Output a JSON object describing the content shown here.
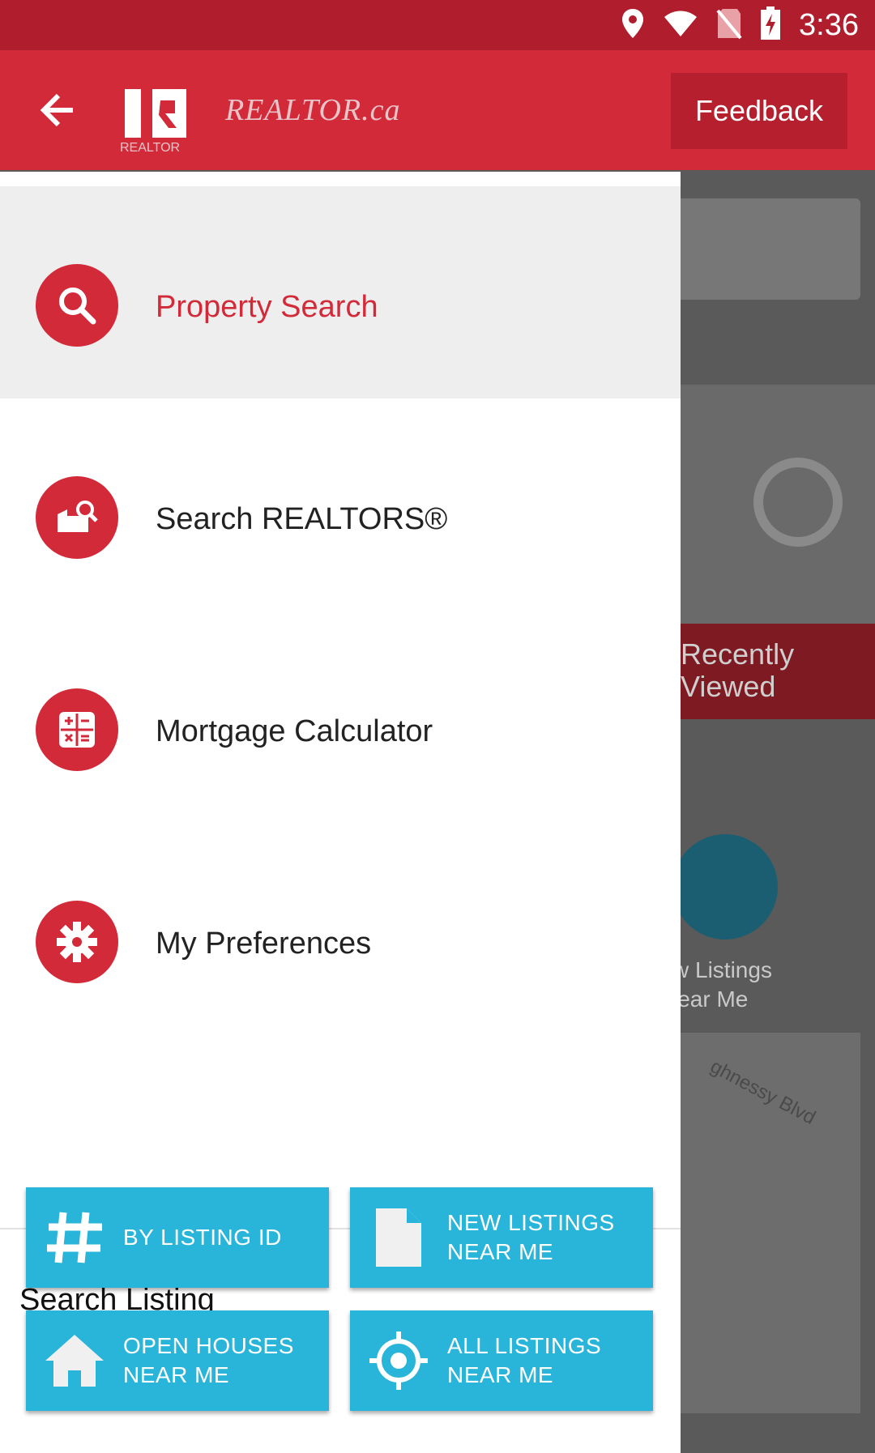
{
  "status_bar": {
    "time": "3:36",
    "icons": [
      "location-icon",
      "wifi-icon",
      "no-sim-icon",
      "battery-charging-icon"
    ]
  },
  "toolbar": {
    "logo_text": "REALTOR.ca",
    "logo_subtext": "REALTOR",
    "feedback_label": "Feedback"
  },
  "drawer": {
    "items": [
      {
        "label": "Property Search",
        "icon": "search-icon",
        "selected": true
      },
      {
        "label": "Search REALTORS®",
        "icon": "realtor-search-icon",
        "selected": false
      },
      {
        "label": "Mortgage Calculator",
        "icon": "calculator-icon",
        "selected": false
      },
      {
        "label": "My Preferences",
        "icon": "gear-icon",
        "selected": false
      }
    ],
    "section_title": "Search Listing",
    "tiles": [
      {
        "label": "BY LISTING ID",
        "icon": "hash-icon"
      },
      {
        "label": "NEW LISTINGS\nNEAR ME",
        "icon": "document-icon"
      },
      {
        "label": "OPEN HOUSES\nNEAR ME",
        "icon": "house-icon"
      },
      {
        "label": "ALL LISTINGS\nNEAR ME",
        "icon": "crosshair-icon"
      }
    ]
  },
  "background": {
    "recently_viewed": "Recently\nViewed",
    "new_listings": "w Listings\nlear Me",
    "map_street": "ghnessy Blvd"
  },
  "colors": {
    "brand_red": "#d32a3a",
    "status_red": "#b01e2e",
    "tile_blue": "#29b5d9"
  }
}
